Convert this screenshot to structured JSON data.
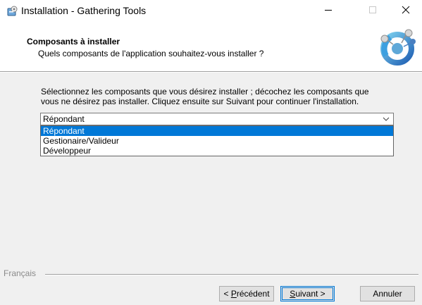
{
  "window": {
    "title": "Installation - Gathering Tools"
  },
  "titlebar_controls": {
    "minimize_icon": "minimize-icon",
    "maximize_icon": "maximize-icon",
    "close_icon": "close-icon"
  },
  "header": {
    "title": "Composants à installer",
    "subtitle": "Quels composants de l'application souhaitez-vous installer ?"
  },
  "body": {
    "instructions_line1": "Sélectionnez les composants que vous désirez installer ; décochez les composants que",
    "instructions_line2": "vous ne désirez pas installer. Cliquez ensuite sur Suivant pour continuer l'installation."
  },
  "combo": {
    "selected": "Répondant",
    "options": [
      "Répondant",
      "Gestionaire/Valideur",
      "Développeur"
    ],
    "highlighted_index": 0
  },
  "footer": {
    "language": "Français",
    "prev_prefix": "< ",
    "prev_accel": "P",
    "prev_rest": "récédent",
    "next_accel": "S",
    "next_rest": "uivant >",
    "cancel": "Annuler"
  },
  "colors": {
    "selection": "#0078d7",
    "accent": "#0078d7"
  }
}
